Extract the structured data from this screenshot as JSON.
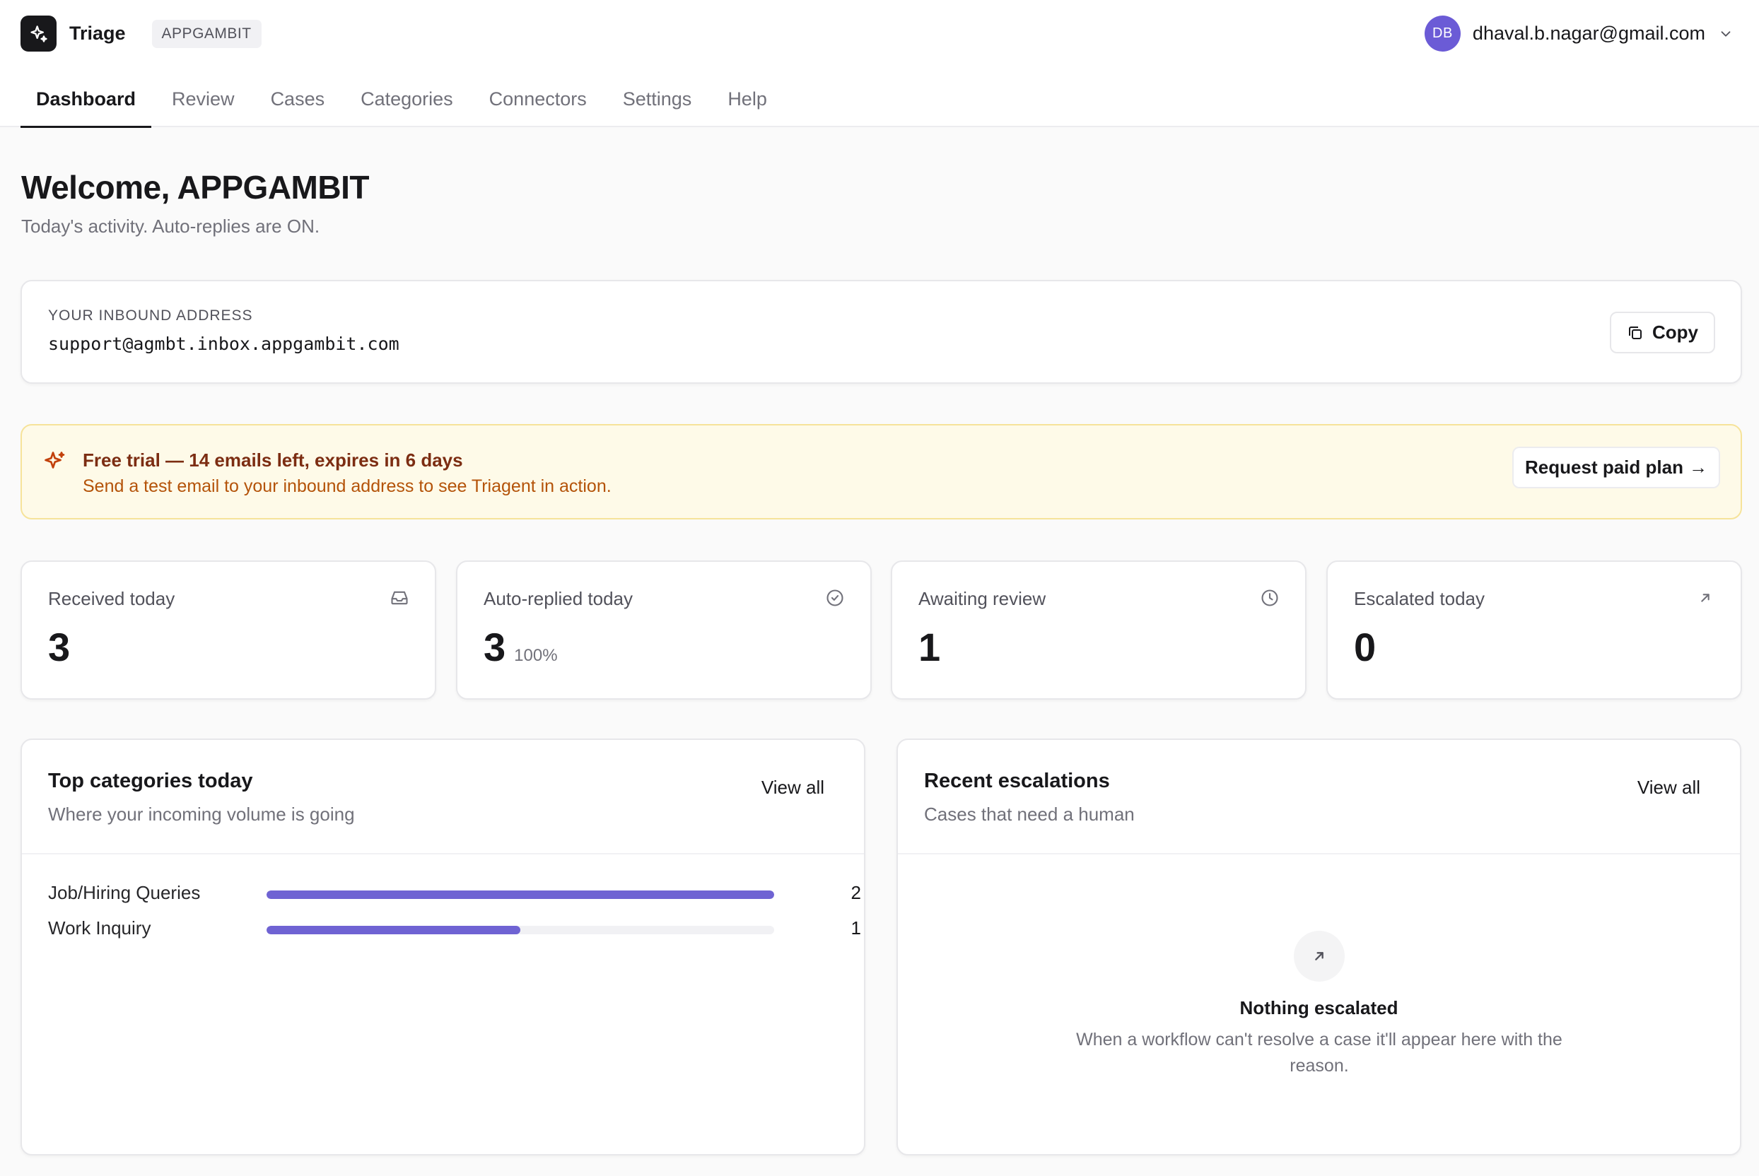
{
  "app": {
    "brand": "Triage",
    "org": "APPGAMBIT"
  },
  "user": {
    "initials": "DB",
    "email": "dhaval.b.nagar@gmail.com"
  },
  "nav": {
    "tabs": [
      "Dashboard",
      "Review",
      "Cases",
      "Categories",
      "Connectors",
      "Settings",
      "Help"
    ],
    "active": "Dashboard"
  },
  "page": {
    "title": "Welcome, APPGAMBIT",
    "subtitle": "Today's activity. Auto-replies are ON."
  },
  "inbound": {
    "label": "YOUR INBOUND ADDRESS",
    "address": "support@agmbt.inbox.appgambit.com",
    "copy_label": "Copy"
  },
  "trial": {
    "title": "Free trial — 14 emails left, expires in 6 days",
    "message": "Send a test email to your inbound address to see Triagent in action.",
    "button_label": "Request paid plan",
    "button_arrow": "→"
  },
  "stats": [
    {
      "label": "Received today",
      "value": "3",
      "sub": "",
      "icon": "inbox-icon"
    },
    {
      "label": "Auto-replied today",
      "value": "3",
      "sub": "100%",
      "icon": "check-circle-icon"
    },
    {
      "label": "Awaiting review",
      "value": "1",
      "sub": "",
      "icon": "clock-icon"
    },
    {
      "label": "Escalated today",
      "value": "0",
      "sub": "",
      "icon": "arrow-up-right-icon"
    }
  ],
  "top_categories": {
    "title": "Top categories today",
    "description": "Where your incoming volume is going",
    "view_all": "View all",
    "items": [
      {
        "name": "Job/Hiring Queries",
        "count": "2",
        "share": 1.0
      },
      {
        "name": "Work Inquiry",
        "count": "1",
        "share": 0.5
      }
    ]
  },
  "escalations": {
    "title": "Recent escalations",
    "description": "Cases that need a human",
    "view_all": "View all",
    "empty_title": "Nothing escalated",
    "empty_message": "When a workflow can't resolve a case it'll appear here with the reason."
  },
  "colors": {
    "accent": "#6f63d3",
    "avatar": "#6b5bd6",
    "trial_bg": "#fefae8",
    "trial_border": "#f6e39a",
    "trial_title": "#7c2d12",
    "trial_text": "#b45309"
  }
}
